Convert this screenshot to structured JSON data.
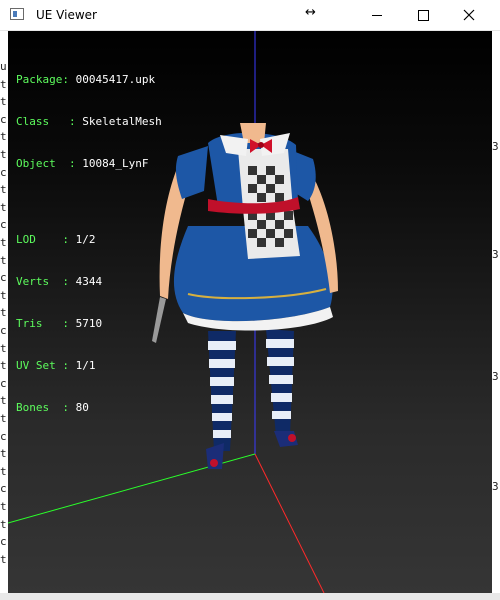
{
  "window": {
    "title": "UE Viewer",
    "resize_cursor": "↔"
  },
  "info": {
    "package_label": "Package",
    "package_value": "00045417.upk",
    "class_label": "Class",
    "class_value": "SkeletalMesh",
    "object_label": "Object",
    "object_value": "10084_LynF",
    "lod_label": "LOD",
    "lod_value": "1/2",
    "verts_label": "Verts",
    "verts_value": "4344",
    "tris_label": "Tris",
    "tris_value": "5710",
    "uvset_label": "UV Set",
    "uvset_value": "1/1",
    "bones_label": "Bones",
    "bones_value": "80"
  },
  "background_app": {
    "left_chars": [
      "u",
      "t",
      "t",
      "c",
      "t",
      "t",
      "c",
      "t",
      "t",
      "c",
      "t",
      "t",
      "c",
      "t",
      "t",
      "c",
      "t",
      "t",
      "c",
      "t",
      "t",
      "c",
      "t",
      "t",
      "c",
      "t",
      "t",
      "c",
      "t"
    ],
    "right_chars": [
      "3",
      "3",
      "3",
      "3"
    ]
  },
  "colors": {
    "info_label": "#5dfc5d",
    "info_value": "#ffffff",
    "axis_x": "#ff2a2a",
    "axis_y": "#2aff2a",
    "axis_z": "#3a3aff"
  },
  "icons": {
    "app": "app-icon",
    "minimize": "minimize-icon",
    "maximize": "maximize-icon",
    "close": "close-icon"
  }
}
